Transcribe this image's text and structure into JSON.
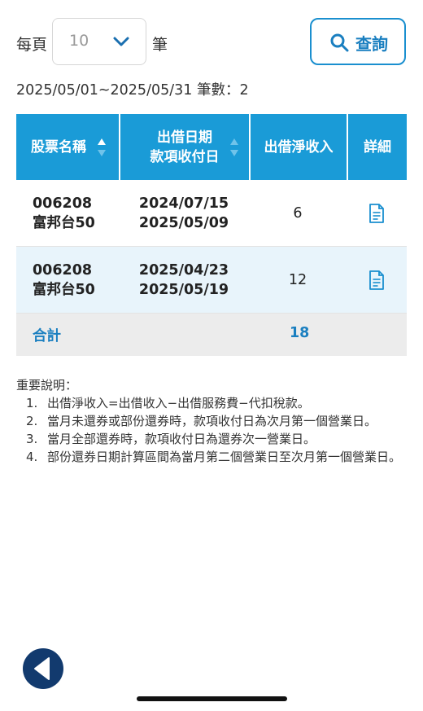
{
  "controls": {
    "per_page_label": "每頁",
    "per_page_value": "10",
    "per_page_unit": "筆",
    "search_label": "查詢"
  },
  "summary": "2025/05/01~2025/05/31 筆數：2",
  "table": {
    "headers": {
      "stock_name": "股票名稱",
      "lend_date": "出借日期",
      "payment_date": "款項收付日",
      "net_income": "出借淨收入",
      "detail": "詳細"
    },
    "rows": [
      {
        "code": "006208",
        "name": "富邦台50",
        "lend_date": "2024/07/15",
        "payment_date": "2025/05/09",
        "net_income": "6"
      },
      {
        "code": "006208",
        "name": "富邦台50",
        "lend_date": "2025/04/23",
        "payment_date": "2025/05/19",
        "net_income": "12"
      }
    ],
    "total_label": "合計",
    "total_value": "18"
  },
  "notes": {
    "title": "重要說明：",
    "items": [
      "出借淨收入=出借收入−出借服務費−代扣稅款。",
      "當月未還券或部份還券時，款項收付日為次月第一個營業日。",
      "當月全部還券時，款項收付日為還券次一營業日。",
      "部份還券日期計算區間為當月第二個營業日至次月第一個營業日。"
    ],
    "numbers": [
      "1.",
      "2.",
      "3.",
      "4."
    ]
  },
  "colors": {
    "header_bg": "#1a9bd7",
    "accent": "#1a7fc0",
    "alt_row_bg": "#e8f4fb",
    "back_button": "#123a6e"
  },
  "icons": {
    "dropdown": "chevron-down-icon",
    "search": "search-icon",
    "sort": "sort-icon",
    "detail": "document-icon",
    "back": "back-arrow-icon"
  }
}
